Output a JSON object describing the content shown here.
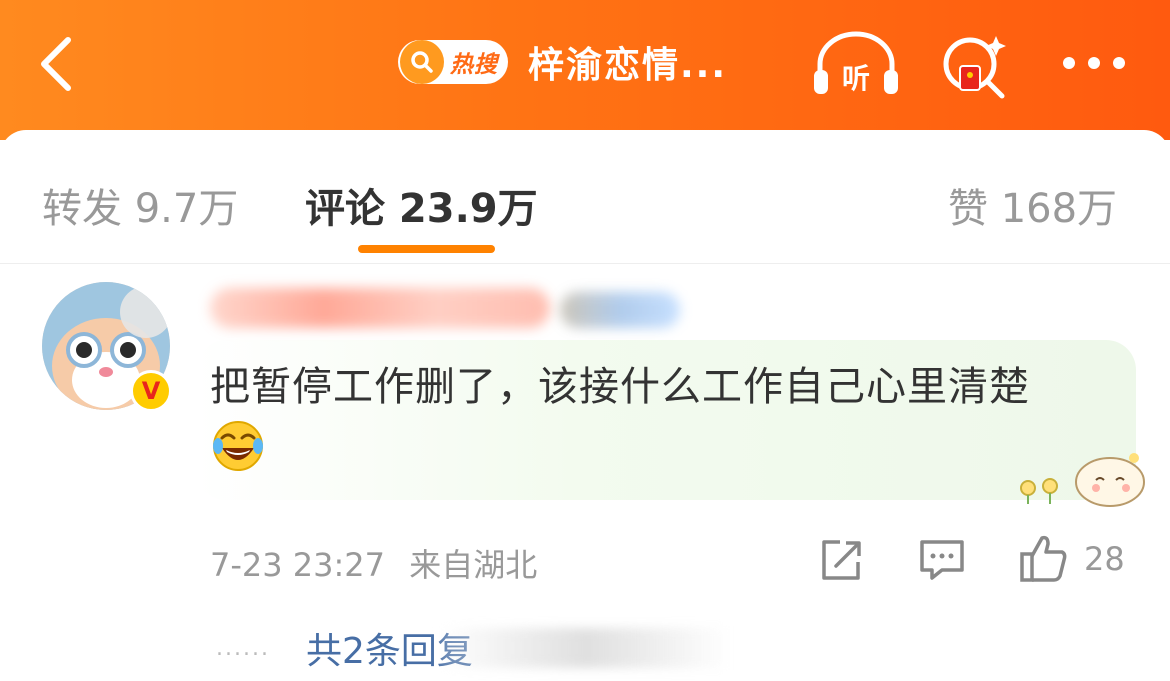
{
  "header": {
    "hot_badge_label": "热搜",
    "title": "梓渝恋情...",
    "listen_label": "听",
    "colors": {
      "gradient_start": "#ff8a1f",
      "gradient_end": "#ff5a0f"
    }
  },
  "tabs": [
    {
      "label": "转发 9.7万",
      "active": false
    },
    {
      "label": "评论 23.9万",
      "active": true
    },
    {
      "label": "赞 168万",
      "active": false
    }
  ],
  "comment": {
    "verified_mark": "V",
    "text": "把暂停工作删了，该接什么工作自己心里清楚",
    "emoji": "laugh-cry",
    "time": "7-23 23:27",
    "location": "来自湖北",
    "like_count": "28",
    "replies_label": "共2条回复"
  },
  "icons": [
    "back-arrow-icon",
    "search-icon",
    "listen-headphones-icon",
    "red-envelope-search-icon",
    "more-dots-icon",
    "share-icon",
    "comment-icon",
    "like-icon"
  ]
}
